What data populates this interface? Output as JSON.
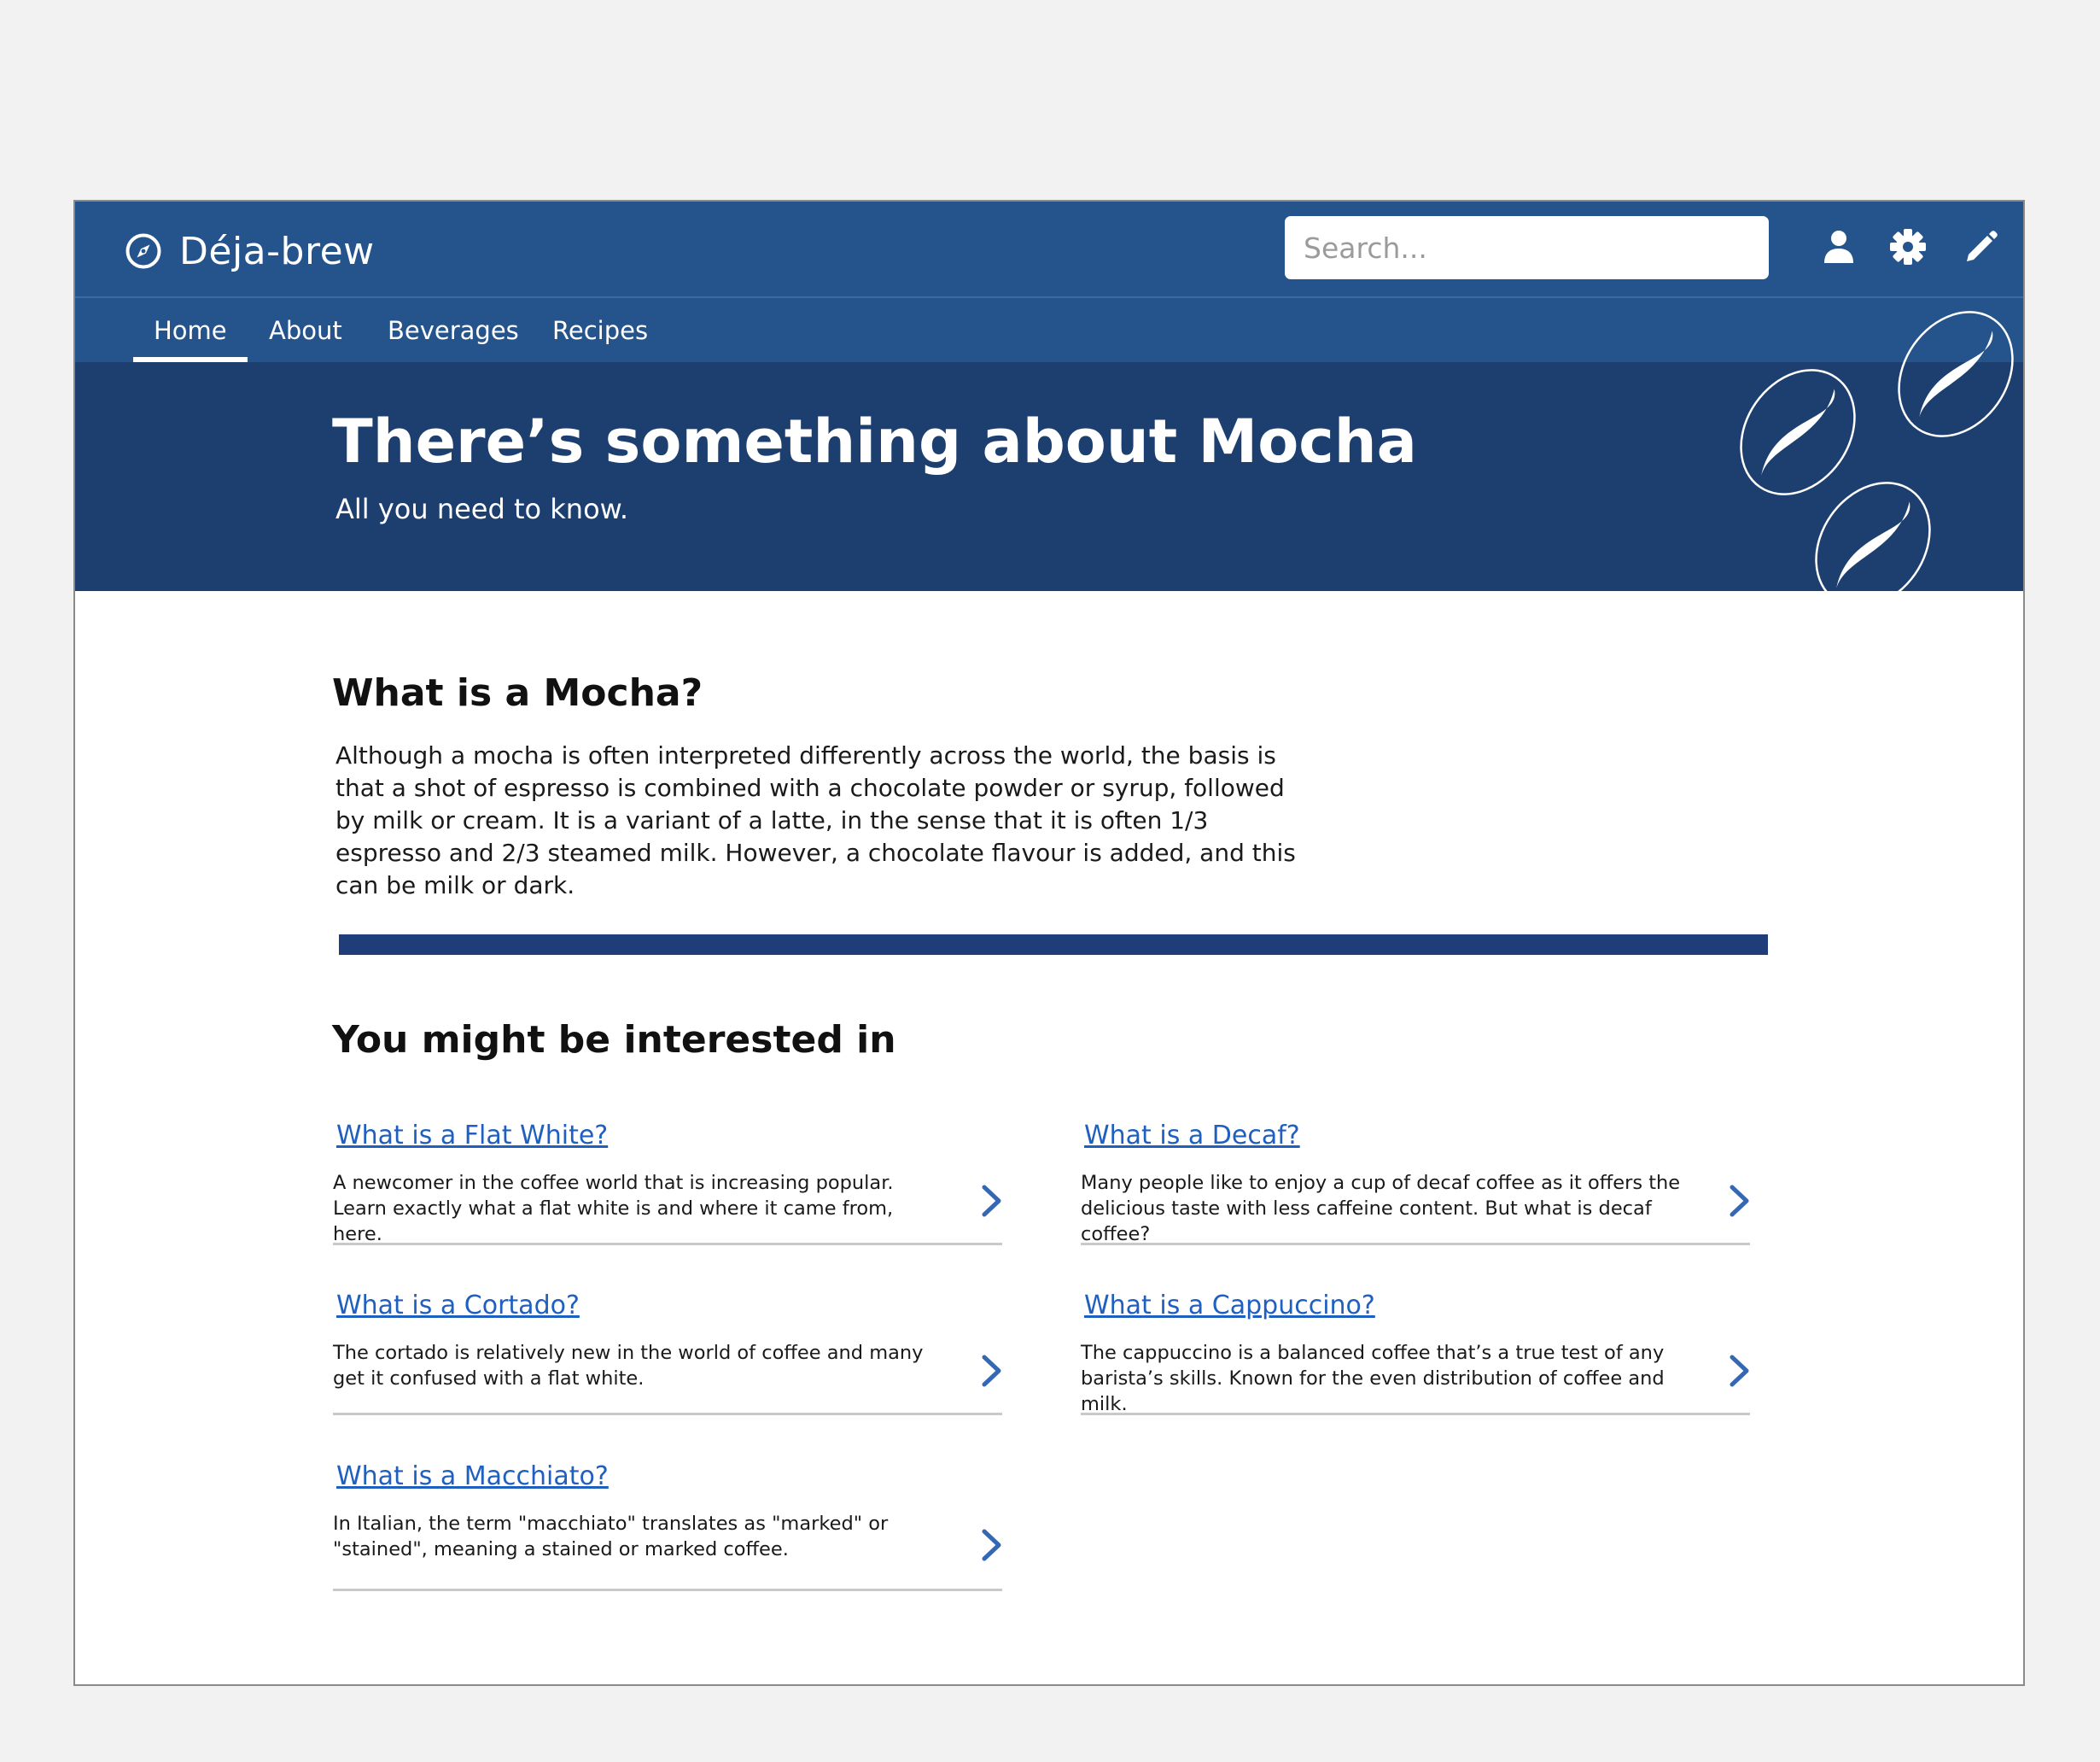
{
  "app": {
    "name": "Déja-brew",
    "logo_icon": "compass-icon"
  },
  "search": {
    "placeholder": "Search..."
  },
  "toolbar": {
    "icons": [
      "user-icon",
      "gear-icon",
      "pencil-icon"
    ]
  },
  "nav": {
    "items": [
      {
        "label": "Home",
        "active": true
      },
      {
        "label": "About",
        "active": false
      },
      {
        "label": "Beverages",
        "active": false
      },
      {
        "label": "Recipes",
        "active": false
      }
    ]
  },
  "hero": {
    "title": "There’s something about Mocha",
    "subtitle": "All you need to know.",
    "decoration": "coffee-bean-icons"
  },
  "intro": {
    "heading": "What is a Mocha?",
    "body": "Although a mocha is often interpreted differently across the world, the basis is that a shot of espresso is combined with a chocolate powder or syrup, followed by milk or cream. It is a variant of a latte, in the sense that it is often 1/3 espresso and 2/3 steamed milk. However, a chocolate flavour is added, and this can be milk or dark."
  },
  "related": {
    "heading": "You might be interested in",
    "items": [
      {
        "title": "What is a Flat White?",
        "desc": "A newcomer in the coffee world that is increasing popular. Learn exactly what a flat white is and where it came from, here."
      },
      {
        "title": "What is a Decaf?",
        "desc": "Many people like to enjoy a cup of decaf coffee as it offers the delicious taste with less caffeine content. But what is decaf coffee?"
      },
      {
        "title": "What is a Cortado?",
        "desc": "The cortado is relatively new in the world of coffee and many get it confused with a flat white."
      },
      {
        "title": "What is a Cappuccino?",
        "desc": "The cappuccino is a balanced coffee that’s a true test of any barista’s skills. Known for the even distribution of coffee and milk."
      },
      {
        "title": "What is a Macchiato?",
        "desc": "In Italian, the term \"macchiato\" translates as \"marked\" or \"stained\", meaning a stained or marked coffee."
      }
    ]
  },
  "colors": {
    "header": "#25548d",
    "hero": "#1d3f70",
    "divider": "#1f3e79",
    "link": "#1f5fbf",
    "page_bg": "#f2f2f2"
  }
}
